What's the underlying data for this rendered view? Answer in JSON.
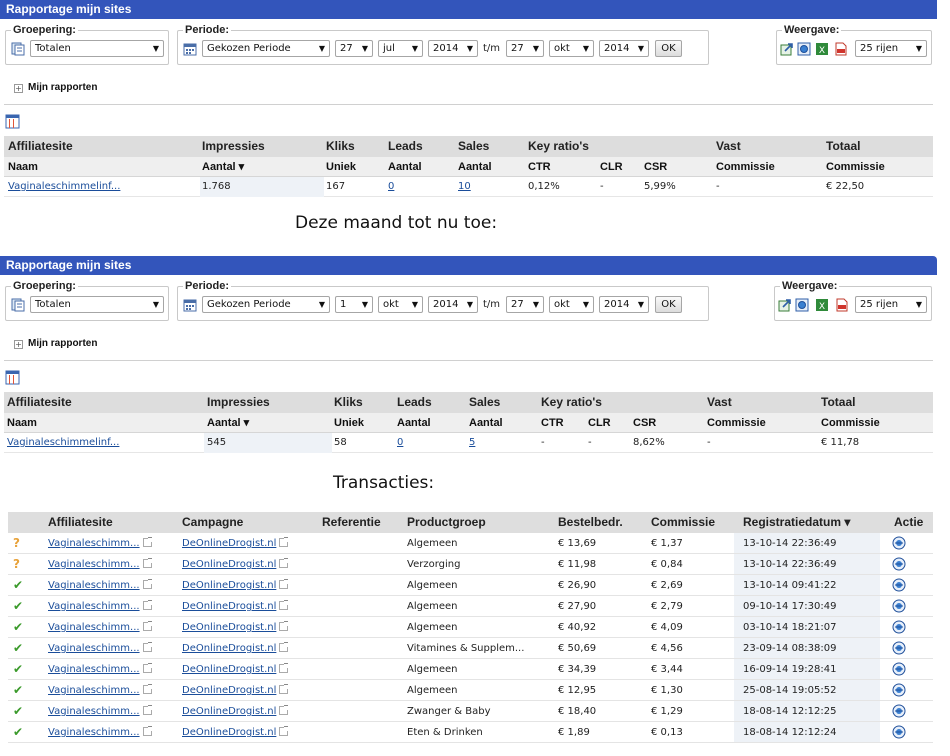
{
  "reports": [
    {
      "title": "Rapportage mijn sites",
      "grouping_label": "Groepering:",
      "grouping_value": "Totalen",
      "period_label": "Periode:",
      "period_value": "Gekozen Periode",
      "from_day": "27",
      "from_month": "jul",
      "from_year": "2014",
      "tm": "t/m",
      "to_day": "27",
      "to_month": "okt",
      "to_year": "2014",
      "ok": "OK",
      "view_label": "Weergave:",
      "rows_value": "25 rijen",
      "my_reports": "Mijn rapporten",
      "group_headers": [
        "Affiliatesite",
        "Impressies",
        "Kliks",
        "Leads",
        "Sales",
        "Key ratio's",
        "Vast",
        "Totaal"
      ],
      "sub_headers": [
        "Naam",
        "Aantal ▾",
        "Uniek",
        "Aantal",
        "Aantal",
        "CTR",
        "CLR",
        "CSR",
        "Commissie",
        "Commissie"
      ],
      "row": [
        "Vaginaleschimmelinf...",
        "1.768",
        "167",
        "0",
        "10",
        "0,12%",
        "-",
        "5,99%",
        "-",
        "€ 22,50"
      ]
    },
    {
      "title": "Rapportage mijn sites",
      "grouping_label": "Groepering:",
      "grouping_value": "Totalen",
      "period_label": "Periode:",
      "period_value": "Gekozen Periode",
      "from_day": "1",
      "from_month": "okt",
      "from_year": "2014",
      "tm": "t/m",
      "to_day": "27",
      "to_month": "okt",
      "to_year": "2014",
      "ok": "OK",
      "view_label": "Weergave:",
      "rows_value": "25 rijen",
      "my_reports": "Mijn rapporten",
      "group_headers": [
        "Affiliatesite",
        "Impressies",
        "Kliks",
        "Leads",
        "Sales",
        "Key ratio's",
        "Vast",
        "Totaal"
      ],
      "sub_headers": [
        "Naam",
        "Aantal ▾",
        "Uniek",
        "Aantal",
        "Aantal",
        "CTR",
        "CLR",
        "CSR",
        "Commissie",
        "Commissie"
      ],
      "row": [
        "Vaginaleschimmelinf...",
        "545",
        "58",
        "0",
        "5",
        "-",
        "-",
        "8,62%",
        "-",
        "€ 11,78"
      ]
    }
  ],
  "caption_month": "Deze maand tot nu toe:",
  "caption_transactions": "Transacties:",
  "transactions": {
    "headers": [
      "Affiliatesite",
      "Campagne",
      "Referentie",
      "Productgroep",
      "Bestelbedr.",
      "Commissie",
      "Registratiedatum ▾",
      "Actie"
    ],
    "rows": [
      {
        "status": "?",
        "site": "Vaginaleschimm...",
        "campaign": "DeOnlineDrogist.nl",
        "ref": "",
        "group": "Algemeen",
        "amount": "€ 13,69",
        "commission": "€ 1,37",
        "date": "13-10-14 22:36:49"
      },
      {
        "status": "?",
        "site": "Vaginaleschimm...",
        "campaign": "DeOnlineDrogist.nl",
        "ref": "",
        "group": "Verzorging",
        "amount": "€ 11,98",
        "commission": "€ 0,84",
        "date": "13-10-14 22:36:49"
      },
      {
        "status": "✔",
        "site": "Vaginaleschimm...",
        "campaign": "DeOnlineDrogist.nl",
        "ref": "",
        "group": "Algemeen",
        "amount": "€ 26,90",
        "commission": "€ 2,69",
        "date": "13-10-14 09:41:22"
      },
      {
        "status": "✔",
        "site": "Vaginaleschimm...",
        "campaign": "DeOnlineDrogist.nl",
        "ref": "",
        "group": "Algemeen",
        "amount": "€ 27,90",
        "commission": "€ 2,79",
        "date": "09-10-14 17:30:49"
      },
      {
        "status": "✔",
        "site": "Vaginaleschimm...",
        "campaign": "DeOnlineDrogist.nl",
        "ref": "",
        "group": "Algemeen",
        "amount": "€ 40,92",
        "commission": "€ 4,09",
        "date": "03-10-14 18:21:07"
      },
      {
        "status": "✔",
        "site": "Vaginaleschimm...",
        "campaign": "DeOnlineDrogist.nl",
        "ref": "",
        "group": "Vitamines & Supplem...",
        "amount": "€ 50,69",
        "commission": "€ 4,56",
        "date": "23-09-14 08:38:09"
      },
      {
        "status": "✔",
        "site": "Vaginaleschimm...",
        "campaign": "DeOnlineDrogist.nl",
        "ref": "",
        "group": "Algemeen",
        "amount": "€ 34,39",
        "commission": "€ 3,44",
        "date": "16-09-14 19:28:41"
      },
      {
        "status": "✔",
        "site": "Vaginaleschimm...",
        "campaign": "DeOnlineDrogist.nl",
        "ref": "",
        "group": "Algemeen",
        "amount": "€ 12,95",
        "commission": "€ 1,30",
        "date": "25-08-14 19:05:52"
      },
      {
        "status": "✔",
        "site": "Vaginaleschimm...",
        "campaign": "DeOnlineDrogist.nl",
        "ref": "",
        "group": "Zwanger & Baby",
        "amount": "€ 18,40",
        "commission": "€ 1,29",
        "date": "18-08-14 12:12:25"
      },
      {
        "status": "✔",
        "site": "Vaginaleschimm...",
        "campaign": "DeOnlineDrogist.nl",
        "ref": "",
        "group": "Eten & Drinken",
        "amount": "€ 1,89",
        "commission": "€ 0,13",
        "date": "18-08-14 12:12:24"
      }
    ]
  },
  "colors": {
    "titlebar": "#3355bb",
    "link": "#1a4d9a",
    "pending": "#e8a23a",
    "approved": "#3a9a2a"
  }
}
